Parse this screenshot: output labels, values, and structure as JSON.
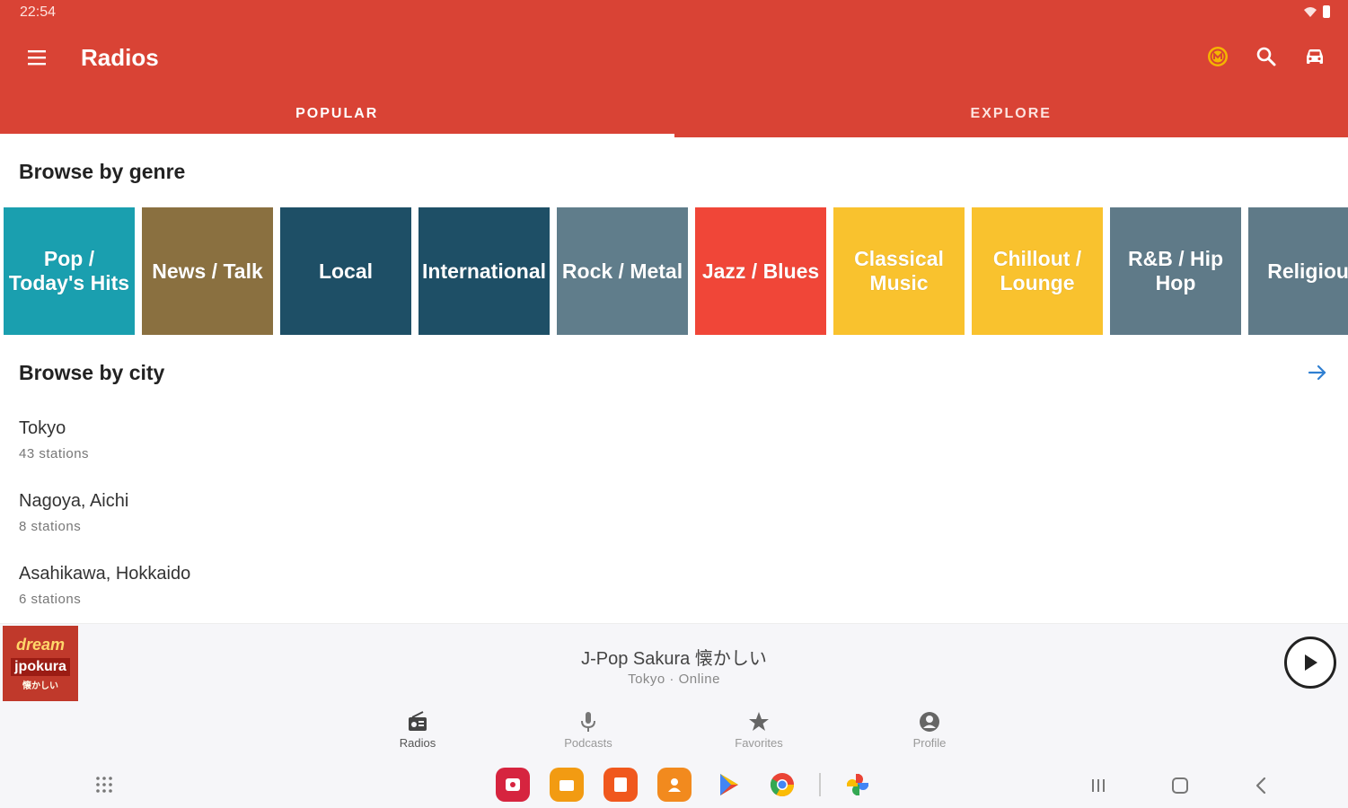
{
  "status_bar": {
    "time": "22:54"
  },
  "app_bar": {
    "title": "Radios"
  },
  "tabs": [
    {
      "label": "POPULAR",
      "active": true
    },
    {
      "label": "EXPLORE",
      "active": false
    }
  ],
  "browse_by_genre": {
    "title": "Browse by genre",
    "genres": [
      {
        "label": "Pop / Today's Hits",
        "color": "#1a9faf"
      },
      {
        "label": "News / Talk",
        "color": "#8a7040"
      },
      {
        "label": "Local",
        "color": "#1e4f66"
      },
      {
        "label": "International",
        "color": "#1e4f66"
      },
      {
        "label": "Rock / Metal",
        "color": "#607d8b"
      },
      {
        "label": "Jazz / Blues",
        "color": "#f04638"
      },
      {
        "label": "Classical Music",
        "color": "#f9c22e"
      },
      {
        "label": "Chillout / Lounge",
        "color": "#f9c22e"
      },
      {
        "label": "R&B / Hip Hop",
        "color": "#5f7a88"
      },
      {
        "label": "Religious",
        "color": "#5f7a88"
      }
    ]
  },
  "browse_by_city": {
    "title": "Browse by city",
    "cities": [
      {
        "name": "Tokyo",
        "count": "43 stations"
      },
      {
        "name": "Nagoya, Aichi",
        "count": "8 stations"
      },
      {
        "name": "Asahikawa, Hokkaido",
        "count": "6 stations"
      }
    ]
  },
  "player": {
    "art": {
      "line1": "dream",
      "line2": "jpokura",
      "line3": "懐かしい"
    },
    "title": "J-Pop Sakura 懐かしい",
    "subtitle": "Tokyo · Online"
  },
  "bottom_nav": [
    {
      "label": "Radios",
      "icon": "radio-icon",
      "active": true
    },
    {
      "label": "Podcasts",
      "icon": "microphone-icon",
      "active": false
    },
    {
      "label": "Favorites",
      "icon": "star-icon",
      "active": false
    },
    {
      "label": "Profile",
      "icon": "profile-icon",
      "active": false
    }
  ],
  "colors": {
    "primary": "#d94335",
    "accent_arrow": "#2f7fd1",
    "premium_badge": "#f5b400"
  }
}
